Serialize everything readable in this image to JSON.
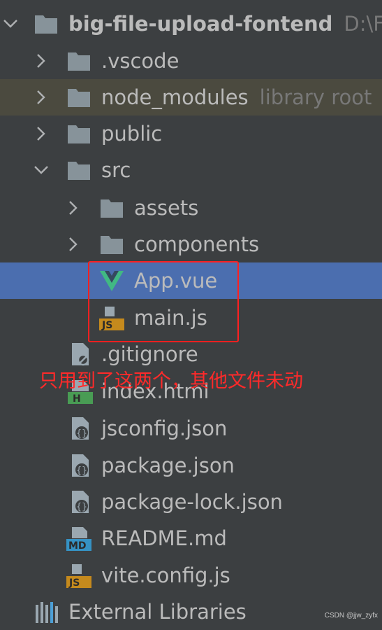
{
  "project": {
    "name": "big-file-upload-fontend",
    "path": "D:\\Fo",
    "library_hint": "library root"
  },
  "items": {
    "vscode": ".vscode",
    "node_modules": "node_modules",
    "public": "public",
    "src": "src",
    "assets": "assets",
    "components": "components",
    "app_vue": "App.vue",
    "main_js": "main.js",
    "gitignore": ".gitignore",
    "index_html": "index.html",
    "jsconfig": "jsconfig.json",
    "package": "package.json",
    "package_lock": "package-lock.json",
    "readme": "README.md",
    "vite_config": "vite.config.js",
    "external_libraries": "External Libraries"
  },
  "badges": {
    "js": "JS",
    "md": "MD",
    "html": "H"
  },
  "annotation": "只用到了这两个，其他文件未动",
  "watermark": "CSDN @jjw_zyfx",
  "colors": {
    "background": "#3c3f41",
    "selection": "#4b6eaf",
    "excluded_row": "#4b4a3f",
    "folder": "#87939a",
    "annotation_red": "#ff2020",
    "vue_green": "#41b883"
  }
}
